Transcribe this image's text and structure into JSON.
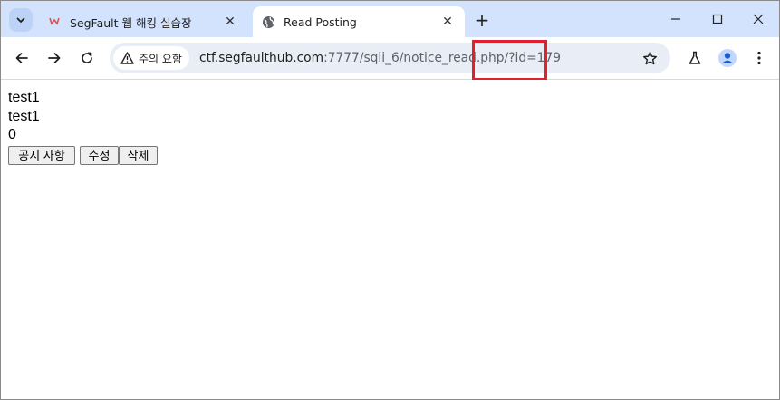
{
  "browser": {
    "tabs": [
      {
        "title": "SegFault 웹 해킹 실습장",
        "active": false,
        "favicon": "segfault-favicon"
      },
      {
        "title": "Read Posting",
        "active": true,
        "favicon": "globe-icon"
      }
    ],
    "new_tab_label": "+",
    "security_chip": "주의 요함",
    "url_host": "ctf.segfaulthub.com",
    "url_rest": ":7777/sqli_6/notice_read.php/?id=179",
    "highlight_color": "#e0202a",
    "accent_tabstrip": "#d3e3fd"
  },
  "page": {
    "lines": [
      "test1",
      "test1",
      "0"
    ],
    "buttons": {
      "notice": "공지 사항",
      "edit": "수정",
      "delete": "삭제"
    }
  }
}
